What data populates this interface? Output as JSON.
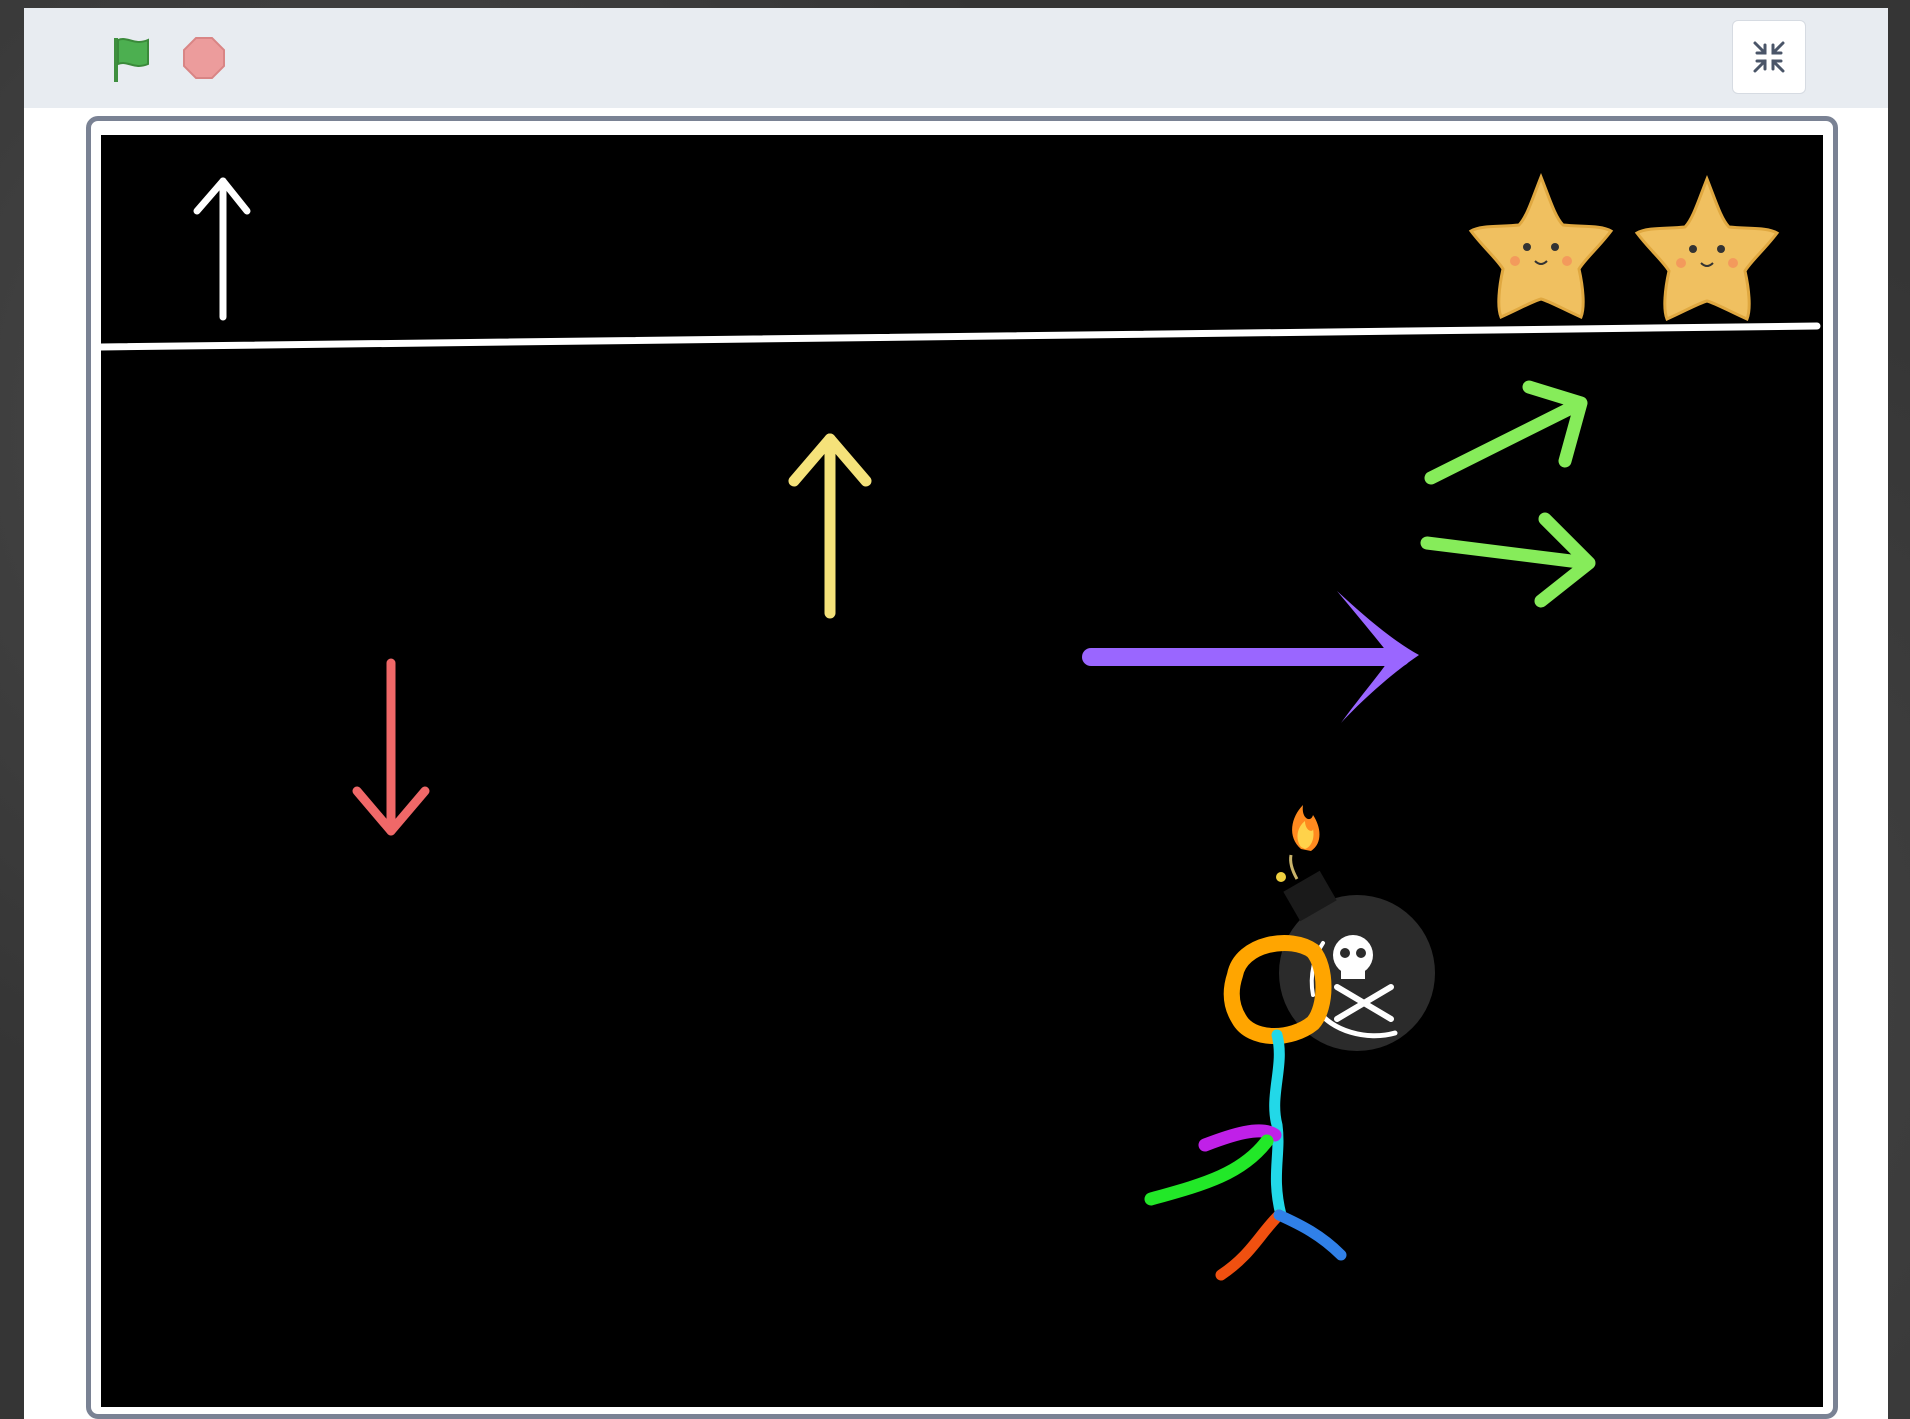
{
  "toolbar": {
    "green_flag_icon": "green-flag",
    "stop_icon": "stop-sign",
    "fullscreen_icon": "exit-fullscreen"
  },
  "colors": {
    "toolbar_bg": "#e8ecf1",
    "stage_bg": "#000000",
    "flag": "#4caf50",
    "stop": "#ec9c9c",
    "arrow_white": "#ffffff",
    "arrow_yellow": "#f5e27a",
    "arrow_red": "#f06868",
    "arrow_purple": "#9a66ff",
    "arrow_green": "#86ec5a",
    "star": "#f0c060",
    "stickman_head": "#ffa500",
    "stickman_body": "#22d8e8"
  },
  "stage": {
    "sprites": [
      "up-arrow-white",
      "star",
      "star",
      "divider-line",
      "up-arrow-yellow",
      "down-arrow-red",
      "right-arrow-purple",
      "green-arrow-up-right",
      "green-arrow-right",
      "bomb",
      "stickman"
    ]
  }
}
